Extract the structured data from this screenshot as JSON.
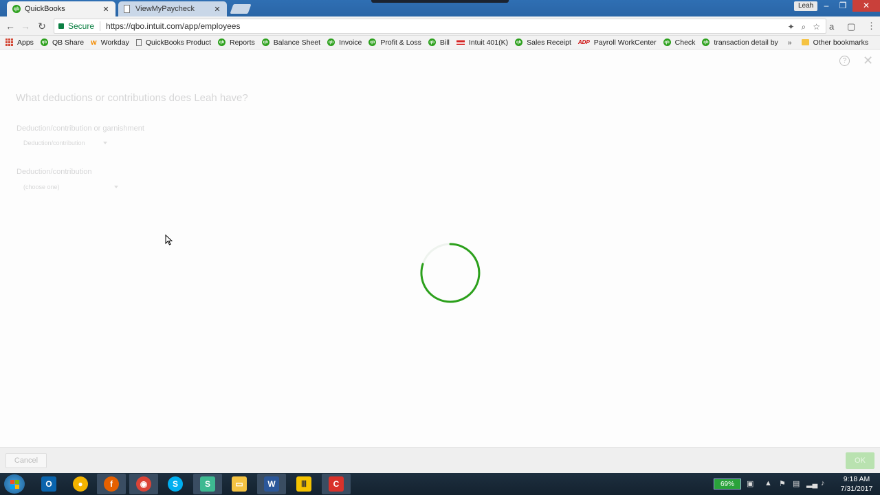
{
  "browser": {
    "tabs": [
      {
        "label": "QuickBooks",
        "active": true
      },
      {
        "label": "ViewMyPaycheck",
        "active": false
      }
    ],
    "user_label": "Leah",
    "secure_label": "Secure",
    "url": "https://qbo.intuit.com/app/employees",
    "bookmarks": [
      {
        "label": "Apps",
        "icon": "apps-grid-icon"
      },
      {
        "label": "QB Share",
        "icon": "quickbooks-icon"
      },
      {
        "label": "Workday",
        "icon": "workday-icon"
      },
      {
        "label": "QuickBooks Product",
        "icon": "page-icon"
      },
      {
        "label": "Reports",
        "icon": "quickbooks-icon"
      },
      {
        "label": "Balance Sheet",
        "icon": "quickbooks-icon"
      },
      {
        "label": "Invoice",
        "icon": "quickbooks-icon"
      },
      {
        "label": "Profit & Loss",
        "icon": "quickbooks-icon"
      },
      {
        "label": "Bill",
        "icon": "quickbooks-icon"
      },
      {
        "label": "Intuit 401(K)",
        "icon": "flag-icon"
      },
      {
        "label": "Sales Receipt",
        "icon": "quickbooks-icon"
      },
      {
        "label": "Payroll WorkCenter",
        "icon": "adp-icon"
      },
      {
        "label": "Check",
        "icon": "quickbooks-icon"
      },
      {
        "label": "transaction detail by",
        "icon": "quickbooks-icon"
      }
    ],
    "more_label": "»",
    "other_bookmarks": "Other bookmarks"
  },
  "modal": {
    "question": "What deductions or contributions does Leah have?",
    "field1_label": "Deduction/contribution or garnishment",
    "field1_value": "Deduction/contribution",
    "field2_label": "Deduction/contribution",
    "field2_placeholder": "(choose one)",
    "loading": true,
    "spinner_color": "#2ca01c"
  },
  "footer": {
    "cancel_label": "Cancel",
    "ok_label": "OK"
  },
  "taskbar": {
    "apps": [
      "outlook",
      "chrome-canary",
      "firefox",
      "chrome",
      "skype",
      "slack",
      "file-explorer",
      "word",
      "quickbooks-desktop",
      "camtasia"
    ],
    "battery": "69%",
    "time": "9:18 AM",
    "date": "7/31/2017"
  }
}
